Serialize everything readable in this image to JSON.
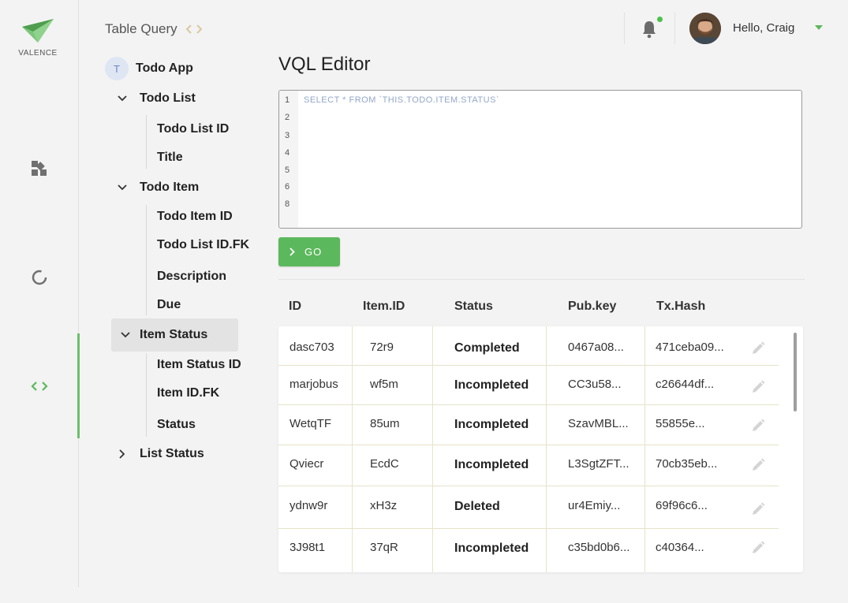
{
  "app": {
    "logo_text": "VALENCE",
    "breadcrumb_title": "Table Query"
  },
  "user": {
    "greeting": "Hello, Craig"
  },
  "tree": {
    "root_badge": "T",
    "root_label": "Todo App",
    "groups": [
      {
        "label": "Todo List",
        "expanded": true,
        "children": [
          "Todo List ID",
          "Title"
        ]
      },
      {
        "label": "Todo Item",
        "expanded": true,
        "children": [
          "Todo Item ID",
          "Todo List ID.FK",
          "Description",
          "Due"
        ]
      },
      {
        "label": "Item Status",
        "expanded": true,
        "active": true,
        "children": [
          "Item Status ID",
          "Item ID.FK",
          "Status"
        ]
      },
      {
        "label": "List Status",
        "expanded": false,
        "children": []
      }
    ]
  },
  "editor": {
    "title": "VQL Editor",
    "line_numbers": [
      "1",
      "2",
      "3",
      "4",
      "5",
      "6",
      "8"
    ],
    "code": "SELECT * FROM `THIS.TODO.ITEM.STATUS`",
    "go_label": "GO"
  },
  "table": {
    "headers": [
      "ID",
      "Item.ID",
      "Status",
      "Pub.key",
      "Tx.Hash"
    ],
    "rows": [
      [
        "dasc703",
        "72r9",
        "Completed",
        "0467a08...",
        "471ceba09..."
      ],
      [
        "marjobus",
        "wf5m",
        "Incompleted",
        "CC3u58...",
        "c26644df..."
      ],
      [
        "WetqTF",
        "85um",
        "Incompleted",
        "SzavMBL...",
        "55855e..."
      ],
      [
        "Qviecr",
        "EcdC",
        "Incompleted",
        "L3SgtZFT...",
        "70cb35eb..."
      ],
      [
        "ydnw9r",
        "xH3z",
        "Deleted",
        "ur4Emiy...",
        "69f96c6..."
      ],
      [
        "3J98t1",
        "37qR",
        "Incompleted",
        "c35bd0b6...",
        "c40364..."
      ]
    ]
  },
  "colors": {
    "accent": "#5cb85c",
    "notification_dot": "#4cc14a"
  },
  "icons": {
    "rail": [
      "dashboard-icon",
      "loading-icon",
      "code-icon"
    ],
    "header": [
      "bell-icon",
      "dropdown-caret-icon"
    ],
    "row_action": "pencil-icon"
  }
}
